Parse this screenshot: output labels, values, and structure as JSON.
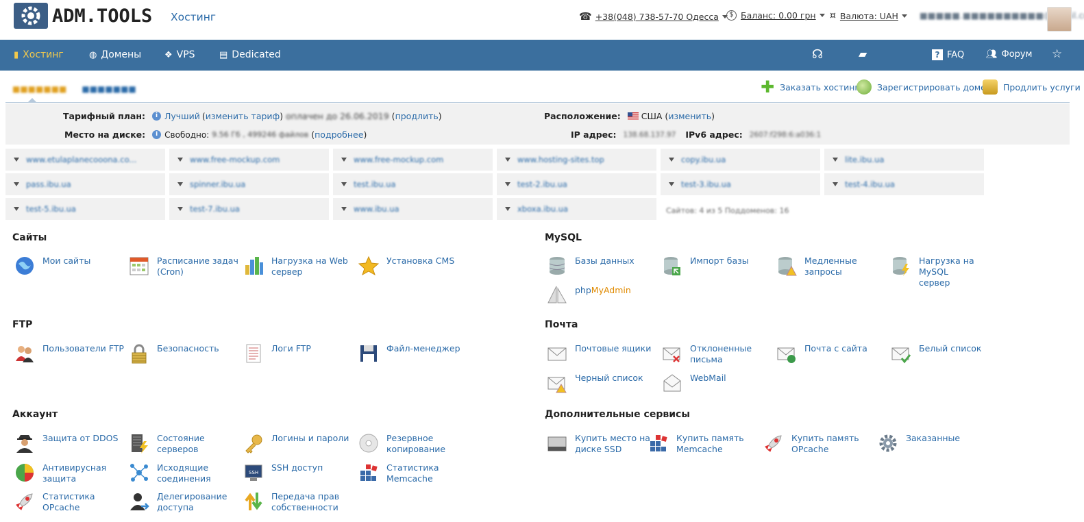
{
  "header": {
    "logo_text": "ADM.TOOLS",
    "section_title": "Хостинг",
    "phone": "+38(048) 738-57-70 Одесса",
    "balance": "Баланс: 0.00 грн",
    "currency": "Валюта: UAH",
    "email": "■■■■■.■■■■■■■■■■@gmail.com"
  },
  "nav": {
    "items": [
      {
        "label": "Хостинг",
        "icon": "server-icon",
        "active": true
      },
      {
        "label": "Домены",
        "icon": "globe-icon"
      },
      {
        "label": "VPS",
        "icon": "vps-icon"
      },
      {
        "label": "Dedicated",
        "icon": "dedicated-icon"
      }
    ],
    "faq": "FAQ",
    "forum": "Форум"
  },
  "account_tabs": [
    {
      "label": "■■■■■■■",
      "active": true
    },
    {
      "label": "■■■■■■■"
    }
  ],
  "actions": {
    "order_hosting": "Заказать хостинг",
    "register_domain": "Зарегистрировать домен",
    "extend_services": "Продлить услуги"
  },
  "info": {
    "plan_label": "Тарифный план:",
    "plan_name": "Лучший",
    "change_plan": "изменить тариф",
    "paid_until": "оплачен до 26.06.2019",
    "extend": "продлить",
    "disk_label": "Место на диске:",
    "disk_free": "Свободно:",
    "disk_value": "9.56 Гб , 499246 файлов",
    "details": "подробнее",
    "location_label": "Расположение:",
    "location_value": "США",
    "change": "изменить",
    "ip_label": "IP адрес:",
    "ip_value": "138.68.137.97",
    "ipv6_label": "IPv6 адрес:",
    "ipv6_value": "2607:f298:6:a036:1"
  },
  "domains": [
    "www.etulaplanecooona.co...",
    "www.free-mockup.com",
    "www.free-mockup.com",
    "www.hosting-sites.top",
    "copy.ibu.ua",
    "lite.ibu.ua",
    "pass.ibu.ua",
    "spinner.ibu.ua",
    "test.ibu.ua",
    "test-2.ibu.ua",
    "test-3.ibu.ua",
    "test-4.ibu.ua",
    "test-5.ibu.ua",
    "test-7.ibu.ua",
    "www.ibu.ua",
    "xboxa.ibu.ua"
  ],
  "domains_count": "Сайтов: 4 из 5   Поддоменов: 16",
  "sections": {
    "sites": {
      "title": "Сайты",
      "items": [
        "Мои сайты",
        "Расписание задач\n(Cron)",
        "Нагрузка на Web\nсервер",
        "Установка CMS"
      ]
    },
    "mysql": {
      "title": "MySQL",
      "items": [
        "Базы данных",
        "Импорт базы",
        "Медленные запросы",
        "Нагрузка на MySQL\nсервер"
      ],
      "pma_php": "php",
      "pma_rest": "MyAdmin"
    },
    "ftp": {
      "title": "FTP",
      "items": [
        "Пользователи FTP",
        "Безопасность",
        "Логи FTP",
        "Файл-менеджер"
      ]
    },
    "mail": {
      "title": "Почта",
      "items": [
        "Почтовые ящики",
        "Отклоненные\nписьма",
        "Почта с сайта",
        "Белый список",
        "Черный список",
        "WebMail"
      ]
    },
    "account": {
      "title": "Аккаунт",
      "items": [
        "Защита от DDOS",
        "Состояние серверов",
        "Логины и пароли",
        "Резервное\nкопирование",
        "Антивирусная\nзащита",
        "Исходящие\nсоединения",
        "SSH доступ",
        "Статистика\nMemcache",
        "Статистика OPcache",
        "Делегирование\nдоступа",
        "Передача прав\nсобственности"
      ]
    },
    "extra": {
      "title": "Дополнительные сервисы",
      "items": [
        "Купить место на\nдиске SSD",
        "Купить память\nMemcache",
        "Купить память\nOPcache",
        "Заказанные"
      ]
    }
  },
  "colors": {
    "nav_bg": "#3b6f9e",
    "link": "#2a6aa8",
    "active_nav": "#f2c94c",
    "panel_bg": "#f1f1f1"
  }
}
